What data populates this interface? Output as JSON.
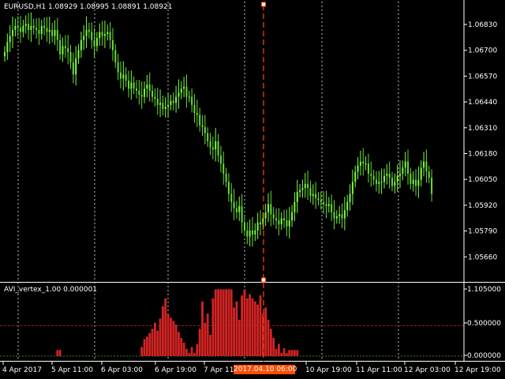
{
  "window": {
    "symbol_header": "EURUSD,H1  1.08929 1.08995 1.08891 1.08921",
    "indicator_header": "AVI_vertex_1.00 0.000001"
  },
  "colors": {
    "background": "#000000",
    "candle_bull": "#7cff3a",
    "candle_bear": "#66dd33",
    "histogram": "#d42323",
    "level_line": "#8a1f1f",
    "grid": "#ffffff",
    "cursor": "#ff4d00"
  },
  "price_axis": {
    "labels": [
      "1.06830",
      "1.06700",
      "1.06570",
      "1.06440",
      "1.06310",
      "1.06180",
      "1.06050",
      "1.05920",
      "1.05790",
      "1.05660"
    ],
    "range": [
      1.0557,
      1.0695
    ]
  },
  "indicator_axis": {
    "labels": [
      "1.105000",
      "0.500000",
      "0.000000"
    ],
    "level": 0.5,
    "range": [
      0,
      1.105
    ]
  },
  "time_axis": {
    "labels": [
      "4 Apr 2017",
      "5 Apr 11:00",
      "6 Apr 03:00",
      "6 Apr 19:00",
      "7 Apr 11",
      "10 Apr 19:00",
      "11 Apr 11:00",
      "12 Apr 03:00",
      "12 Apr 19:00"
    ],
    "cursor_label": "2017.04.10 06:00"
  },
  "chart_data": {
    "type": "candlestick",
    "symbol": "EURUSD",
    "timeframe": "H1",
    "price_series": [
      1.067,
      1.0675,
      1.0678,
      1.0681,
      1.0683,
      1.0682,
      1.068,
      1.0683,
      1.0684,
      1.0681,
      1.0683,
      1.0682,
      1.0681,
      1.0679,
      1.0683,
      1.0682,
      1.068,
      1.0681,
      1.0678,
      1.0681,
      1.0676,
      1.0669,
      1.0673,
      1.0672,
      1.067,
      1.0665,
      1.0659,
      1.0667,
      1.0671,
      1.0676,
      1.0678,
      1.0681,
      1.068,
      1.0676,
      1.0673,
      1.0677,
      1.068,
      1.0678,
      1.0679,
      1.068,
      1.0676,
      1.0671,
      1.0665,
      1.066,
      1.0657,
      1.0659,
      1.0656,
      1.0652,
      1.0655,
      1.0652,
      1.0651,
      1.0649,
      1.0648,
      1.0652,
      1.0654,
      1.0651,
      1.0648,
      1.0647,
      1.0644,
      1.0645,
      1.0642,
      1.0643,
      1.0644,
      1.0646,
      1.0645,
      1.0648,
      1.065,
      1.0652,
      1.0653,
      1.0648,
      1.0648,
      1.0644,
      1.064,
      1.0639,
      1.0634,
      1.0633,
      1.063,
      1.0626,
      1.0623,
      1.0622,
      1.0626,
      1.0619,
      1.0615,
      1.061,
      1.0606,
      1.06,
      1.0596,
      1.0593,
      1.0591,
      1.0594,
      1.0586,
      1.0582,
      1.0579,
      1.0582,
      1.058,
      1.0582,
      1.0586,
      1.0585,
      1.0588,
      1.0591,
      1.0595,
      1.059,
      1.0588,
      1.0587,
      1.0585,
      1.0588,
      1.0587,
      1.0584,
      1.0587,
      1.0591,
      1.0596,
      1.0601,
      1.0602,
      1.0603,
      1.0605,
      1.0603,
      1.0599,
      1.06,
      1.0598,
      1.0597,
      1.0596,
      1.0595,
      1.0594,
      1.0595,
      1.0591,
      1.0588,
      1.0589,
      1.059,
      1.0588,
      1.0592,
      1.0596,
      1.06,
      1.0606,
      1.0611,
      1.0614,
      1.0616,
      1.0615,
      1.0615,
      1.061,
      1.0609,
      1.0607,
      1.0605,
      1.0606,
      1.0606,
      1.0609,
      1.061,
      1.0608,
      1.0604,
      1.0606,
      1.0609,
      1.061,
      1.0613,
      1.0616,
      1.061,
      1.0605,
      1.0607,
      1.0604,
      1.0607,
      1.0613,
      1.0616,
      1.0611,
      1.0608,
      1.06
    ],
    "indicator_series": [
      0,
      0,
      0,
      0,
      0,
      0,
      0,
      0,
      0,
      0,
      0,
      0,
      0,
      0,
      0,
      0,
      0,
      0,
      0,
      0,
      0.1,
      0.1,
      0,
      0,
      0,
      0,
      0,
      0,
      0,
      0,
      0,
      0,
      0,
      0,
      0,
      0,
      0,
      0,
      0,
      0,
      0,
      0,
      0,
      0,
      0,
      0,
      0,
      0,
      0,
      0,
      0,
      0,
      0.15,
      0.28,
      0.32,
      0.38,
      0.45,
      0.55,
      0.42,
      0.62,
      0.82,
      0.95,
      0.7,
      0.63,
      0.58,
      0.52,
      0.4,
      0.3,
      0.22,
      0.12,
      0.05,
      0.15,
      0.05,
      0.2,
      0.45,
      0.9,
      0.55,
      0.7,
      0.35,
      0.95,
      1.1,
      1.1,
      1.1,
      1.1,
      1.1,
      1.1,
      1.1,
      0.8,
      0.9,
      0.6,
      1.0,
      1.1,
      0.95,
      1.02,
      0.95,
      0.9,
      0.85,
      1.0,
      0.7,
      0.8,
      0.6,
      0.45,
      0.3,
      0.12,
      0.2,
      0.05,
      0.13,
      0.05,
      0.1,
      0.1,
      0.1,
      0.1,
      0,
      0,
      0,
      0,
      0,
      0,
      0,
      0,
      0,
      0,
      0,
      0,
      0,
      0,
      0,
      0,
      0,
      0,
      0,
      0,
      0,
      0,
      0,
      0,
      0,
      0,
      0,
      0,
      0,
      0,
      0,
      0,
      0,
      0,
      0,
      0,
      0,
      0,
      0,
      0,
      0,
      0,
      0,
      0,
      0,
      0,
      0,
      0,
      0,
      0,
      0,
      0,
      0,
      0,
      0,
      0,
      0,
      0,
      0,
      0,
      0
    ]
  }
}
